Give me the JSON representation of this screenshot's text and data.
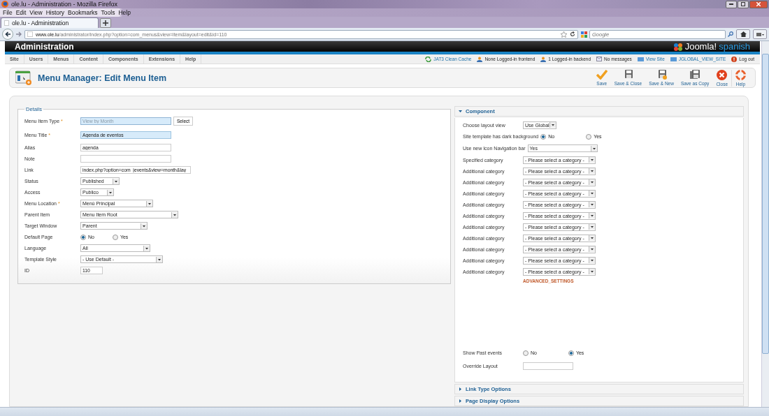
{
  "browser": {
    "title": "ole.lu - Administration - Mozilla Firefox",
    "menu": [
      "File",
      "Edit",
      "View",
      "History",
      "Bookmarks",
      "Tools",
      "Help"
    ],
    "tab": {
      "label": "ole.lu - Administration",
      "selected": true
    },
    "url": {
      "host": "www.ole.lu",
      "path": "/administrator/index.php?option=com_menus&view=item&layout=edit&id=110"
    },
    "search": {
      "placeholder": "Google"
    }
  },
  "header": {
    "title": "Administration",
    "logo": "Joomla!",
    "logo_suffix": "spanish"
  },
  "menu": [
    "Site",
    "Users",
    "Menus",
    "Content",
    "Components",
    "Extensions",
    "Help"
  ],
  "status_items": [
    {
      "kind": "cache",
      "label": "JAT3 Clean Cache",
      "link": true
    },
    {
      "kind": "users",
      "label": "None Logged-in frontend",
      "link": false
    },
    {
      "kind": "users",
      "label": "1 Logged-in backend",
      "link": false
    },
    {
      "kind": "messages",
      "label": "No messages",
      "link": false
    },
    {
      "kind": "site",
      "label": "View Site",
      "link": true
    },
    {
      "kind": "site",
      "label": "JGLOBAL_VIEW_SITE",
      "link": true
    },
    {
      "kind": "logout",
      "label": "Log out",
      "link": false
    }
  ],
  "page_title": "Menu Manager: Edit Menu Item",
  "toolbar": [
    {
      "kind": "save",
      "label": "Save"
    },
    {
      "kind": "save-close",
      "label": "Save & Close"
    },
    {
      "kind": "save-new",
      "label": "Save & New"
    },
    {
      "kind": "save-copy",
      "label": "Save as Copy"
    },
    {
      "kind": "close",
      "label": "Close"
    },
    {
      "kind": "help",
      "label": "Help"
    }
  ],
  "details": {
    "legend": "Details",
    "fields": [
      {
        "kind": "text",
        "label": "Menu Item Type",
        "required_mark": "*",
        "value": "View by Month",
        "disabled": true,
        "highlighted": true,
        "button": "Select"
      },
      {
        "kind": "text",
        "label": "Menu Title",
        "required_mark": "*",
        "value": "Agenda de eventos",
        "disabled": false,
        "highlighted": true
      },
      {
        "kind": "text",
        "label": "Alias",
        "value": "agenda",
        "disabled": false,
        "highlighted": false
      },
      {
        "kind": "text",
        "label": "Note",
        "disabled": false,
        "highlighted": false
      },
      {
        "kind": "text",
        "label": "Link",
        "value": "index.php?option=com_jevents&view=month&lay",
        "disabled": false,
        "highlighted": false
      },
      {
        "kind": "select",
        "label": "Status",
        "value": "Published"
      },
      {
        "kind": "select",
        "label": "Access",
        "value": "Publico"
      },
      {
        "kind": "select",
        "label": "Menu Location",
        "required_mark": "*",
        "value": "Menú Principal"
      },
      {
        "kind": "select",
        "label": "Parent Item",
        "value": "Menu Item Root"
      },
      {
        "kind": "select",
        "label": "Target Window",
        "value": "Parent"
      },
      {
        "kind": "radio",
        "label": "Default Page",
        "options": [
          {
            "label": "No",
            "selected": true
          },
          {
            "label": "Yes",
            "selected": false
          }
        ]
      },
      {
        "kind": "select",
        "label": "Language",
        "value": "All"
      },
      {
        "kind": "select",
        "label": "Template Style",
        "value": "- Use Default -"
      },
      {
        "kind": "text",
        "label": "ID",
        "value": "110",
        "disabled": false,
        "highlighted": false
      }
    ]
  },
  "sections": [
    {
      "title": "Component",
      "expanded": true
    },
    {
      "title": "Link Type Options",
      "expanded": false
    },
    {
      "title": "Page Display Options",
      "expanded": false
    }
  ],
  "component": {
    "fields": [
      {
        "kind": "select",
        "label": "Choose layout view",
        "value": "Use Global"
      },
      {
        "kind": "radio",
        "label": "Site template has dark background",
        "options": [
          {
            "label": "No",
            "selected": true
          },
          {
            "label": "Yes",
            "selected": false
          }
        ]
      },
      {
        "kind": "select",
        "label": "Use new Icon Navigation bar",
        "value": "Yes"
      },
      {
        "kind": "select",
        "label": "Specified category",
        "value": "- Please select a category -"
      },
      {
        "kind": "select",
        "label": "Additional category",
        "value": "- Please select a category -"
      },
      {
        "kind": "select",
        "label": "Additional category",
        "value": "- Please select a category -"
      },
      {
        "kind": "select",
        "label": "Additional category",
        "value": "- Please select a category -"
      },
      {
        "kind": "select",
        "label": "Additional category",
        "value": "- Please select a category -"
      },
      {
        "kind": "select",
        "label": "Additional category",
        "value": "- Please select a category -"
      },
      {
        "kind": "select",
        "label": "Additional category",
        "value": "- Please select a category -"
      },
      {
        "kind": "select",
        "label": "Additional category",
        "value": "- Please select a category -"
      },
      {
        "kind": "select",
        "label": "Additional category",
        "value": "- Please select a category -"
      },
      {
        "kind": "select",
        "label": "Additional category",
        "value": "- Please select a category -"
      },
      {
        "kind": "select",
        "label": "Additional category",
        "value": "- Please select a category -"
      }
    ],
    "advanced_link": "ADVANCED_SETTINGS",
    "bottom_fields": [
      {
        "kind": "radio",
        "label": "Show Past events",
        "options": [
          {
            "label": "No",
            "selected": false
          },
          {
            "label": "Yes",
            "selected": true
          }
        ]
      },
      {
        "kind": "text",
        "label": "Override Layout"
      }
    ]
  }
}
